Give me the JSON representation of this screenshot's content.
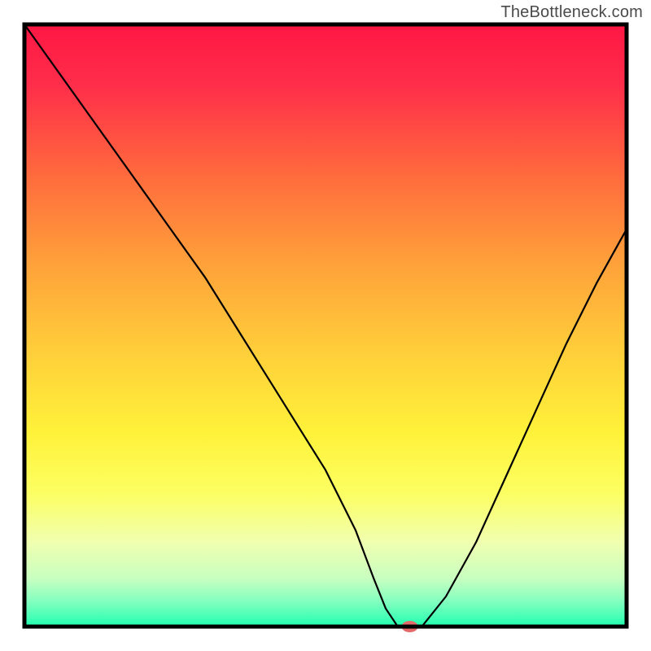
{
  "attribution": "TheBottleneck.com",
  "chart_data": {
    "type": "line",
    "title": "",
    "xlabel": "",
    "ylabel": "",
    "xlim": [
      0,
      100
    ],
    "ylim": [
      0,
      100
    ],
    "axes_visible": false,
    "grid": false,
    "legend": false,
    "background_gradient": {
      "stops": [
        {
          "offset": 0.0,
          "color": "#ff1744"
        },
        {
          "offset": 0.1,
          "color": "#ff2d4a"
        },
        {
          "offset": 0.25,
          "color": "#ff6a3d"
        },
        {
          "offset": 0.4,
          "color": "#ffa23a"
        },
        {
          "offset": 0.55,
          "color": "#ffd03a"
        },
        {
          "offset": 0.68,
          "color": "#fff23a"
        },
        {
          "offset": 0.78,
          "color": "#fcff63"
        },
        {
          "offset": 0.86,
          "color": "#f0ffb0"
        },
        {
          "offset": 0.92,
          "color": "#c8ffc0"
        },
        {
          "offset": 0.96,
          "color": "#7fffbf"
        },
        {
          "offset": 1.0,
          "color": "#1fffaf"
        }
      ]
    },
    "series": [
      {
        "name": "bottleneck-curve",
        "x": [
          0,
          5,
          10,
          15,
          20,
          25,
          30,
          35,
          40,
          45,
          50,
          55,
          58,
          60,
          62,
          64,
          66,
          70,
          75,
          80,
          85,
          90,
          95,
          100
        ],
        "y": [
          100,
          93,
          86,
          79,
          72,
          65,
          58,
          50,
          42,
          34,
          26,
          16,
          8,
          3,
          0,
          0,
          0,
          5,
          14,
          25,
          36,
          47,
          57,
          66
        ]
      }
    ],
    "marker": {
      "name": "optimal-point",
      "x": 64,
      "y": 0,
      "color": "#e36a6a",
      "rx": 10,
      "ry": 7
    },
    "frame_color": "#000000",
    "curve_color": "#000000",
    "curve_width": 2.2
  }
}
